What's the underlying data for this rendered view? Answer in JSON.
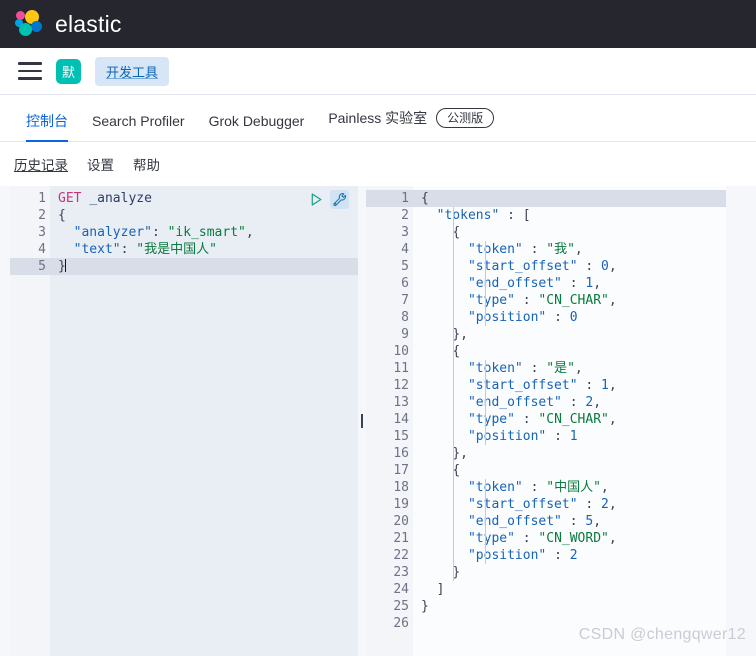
{
  "header": {
    "brand": "elastic",
    "logo_colors": {
      "pink": "#f04e98",
      "yellow": "#fec514",
      "light_blue": "#00a3e0",
      "blue": "#0077cc",
      "teal": "#00bfb3"
    },
    "background": "#25262e"
  },
  "nav": {
    "menu_icon": "hamburger-icon",
    "space_avatar_label": "默",
    "space_avatar_color": "#00bfb3",
    "breadcrumb": "开发工具",
    "breadcrumb_color": "#0b64b4"
  },
  "tabs": {
    "accent": "#0b64dd",
    "items": [
      {
        "label": "控制台",
        "active": true
      },
      {
        "label": "Search Profiler",
        "active": false
      },
      {
        "label": "Grok Debugger",
        "active": false
      },
      {
        "label": "Painless 实验室",
        "active": false,
        "badge": "公测版"
      }
    ]
  },
  "console_actions": [
    {
      "label": "历史记录",
      "underlined": true
    },
    {
      "label": "设置",
      "underlined": false
    },
    {
      "label": "帮助",
      "underlined": false
    }
  ],
  "request_editor": {
    "play_icon": "play-triangle-icon",
    "wrench_icon": "wrench-icon",
    "active_line": 5,
    "lines": [
      {
        "n": "1",
        "fold": "",
        "tokens": [
          {
            "t": "GET ",
            "c": "tk-method"
          },
          {
            "t": "_analyze",
            "c": "tk-url"
          }
        ]
      },
      {
        "n": "2",
        "fold": "▾",
        "tokens": [
          {
            "t": "{",
            "c": "tk-brace"
          }
        ]
      },
      {
        "n": "3",
        "fold": "",
        "tokens": [
          {
            "t": "  ",
            "c": "tk-punc"
          },
          {
            "t": "\"analyzer\"",
            "c": "tk-key"
          },
          {
            "t": ": ",
            "c": "tk-punc"
          },
          {
            "t": "\"ik_smart\"",
            "c": "tk-str"
          },
          {
            "t": ",",
            "c": "tk-punc"
          }
        ]
      },
      {
        "n": "4",
        "fold": "",
        "tokens": [
          {
            "t": "  ",
            "c": "tk-punc"
          },
          {
            "t": "\"text\"",
            "c": "tk-key"
          },
          {
            "t": ": ",
            "c": "tk-punc"
          },
          {
            "t": "\"我是中国人\"",
            "c": "tk-str"
          }
        ]
      },
      {
        "n": "5",
        "fold": "▴",
        "tokens": [
          {
            "t": "}",
            "c": "tk-brace"
          }
        ]
      }
    ]
  },
  "response_editor": {
    "active_line": 1,
    "lines": [
      {
        "n": "1",
        "fold": "▾",
        "tokens": [
          {
            "t": "{",
            "c": "tk-brace"
          }
        ]
      },
      {
        "n": "2",
        "fold": "▾",
        "tokens": [
          {
            "t": "  ",
            "c": "tk-punc"
          },
          {
            "t": "\"tokens\"",
            "c": "tk-key"
          },
          {
            "t": " : ",
            "c": "tk-punc"
          },
          {
            "t": "[",
            "c": "tk-brace"
          }
        ]
      },
      {
        "n": "3",
        "fold": "▾",
        "tokens": [
          {
            "t": "    ",
            "c": "tk-punc"
          },
          {
            "t": "{",
            "c": "tk-brace"
          }
        ]
      },
      {
        "n": "4",
        "fold": "",
        "tokens": [
          {
            "t": "      ",
            "c": "tk-punc"
          },
          {
            "t": "\"token\"",
            "c": "tk-key"
          },
          {
            "t": " : ",
            "c": "tk-punc"
          },
          {
            "t": "\"我\"",
            "c": "tk-str"
          },
          {
            "t": ",",
            "c": "tk-punc"
          }
        ]
      },
      {
        "n": "5",
        "fold": "",
        "tokens": [
          {
            "t": "      ",
            "c": "tk-punc"
          },
          {
            "t": "\"start_offset\"",
            "c": "tk-key"
          },
          {
            "t": " : ",
            "c": "tk-punc"
          },
          {
            "t": "0",
            "c": "tk-num"
          },
          {
            "t": ",",
            "c": "tk-punc"
          }
        ]
      },
      {
        "n": "6",
        "fold": "",
        "tokens": [
          {
            "t": "      ",
            "c": "tk-punc"
          },
          {
            "t": "\"end_offset\"",
            "c": "tk-key"
          },
          {
            "t": " : ",
            "c": "tk-punc"
          },
          {
            "t": "1",
            "c": "tk-num"
          },
          {
            "t": ",",
            "c": "tk-punc"
          }
        ]
      },
      {
        "n": "7",
        "fold": "",
        "tokens": [
          {
            "t": "      ",
            "c": "tk-punc"
          },
          {
            "t": "\"type\"",
            "c": "tk-key"
          },
          {
            "t": " : ",
            "c": "tk-punc"
          },
          {
            "t": "\"CN_CHAR\"",
            "c": "tk-str"
          },
          {
            "t": ",",
            "c": "tk-punc"
          }
        ]
      },
      {
        "n": "8",
        "fold": "",
        "tokens": [
          {
            "t": "      ",
            "c": "tk-punc"
          },
          {
            "t": "\"position\"",
            "c": "tk-key"
          },
          {
            "t": " : ",
            "c": "tk-punc"
          },
          {
            "t": "0",
            "c": "tk-num"
          }
        ]
      },
      {
        "n": "9",
        "fold": "▴",
        "tokens": [
          {
            "t": "    ",
            "c": "tk-punc"
          },
          {
            "t": "}",
            "c": "tk-brace"
          },
          {
            "t": ",",
            "c": "tk-punc"
          }
        ]
      },
      {
        "n": "10",
        "fold": "▾",
        "tokens": [
          {
            "t": "    ",
            "c": "tk-punc"
          },
          {
            "t": "{",
            "c": "tk-brace"
          }
        ]
      },
      {
        "n": "11",
        "fold": "",
        "tokens": [
          {
            "t": "      ",
            "c": "tk-punc"
          },
          {
            "t": "\"token\"",
            "c": "tk-key"
          },
          {
            "t": " : ",
            "c": "tk-punc"
          },
          {
            "t": "\"是\"",
            "c": "tk-str"
          },
          {
            "t": ",",
            "c": "tk-punc"
          }
        ]
      },
      {
        "n": "12",
        "fold": "",
        "tokens": [
          {
            "t": "      ",
            "c": "tk-punc"
          },
          {
            "t": "\"start_offset\"",
            "c": "tk-key"
          },
          {
            "t": " : ",
            "c": "tk-punc"
          },
          {
            "t": "1",
            "c": "tk-num"
          },
          {
            "t": ",",
            "c": "tk-punc"
          }
        ]
      },
      {
        "n": "13",
        "fold": "",
        "tokens": [
          {
            "t": "      ",
            "c": "tk-punc"
          },
          {
            "t": "\"end_offset\"",
            "c": "tk-key"
          },
          {
            "t": " : ",
            "c": "tk-punc"
          },
          {
            "t": "2",
            "c": "tk-num"
          },
          {
            "t": ",",
            "c": "tk-punc"
          }
        ]
      },
      {
        "n": "14",
        "fold": "",
        "tokens": [
          {
            "t": "      ",
            "c": "tk-punc"
          },
          {
            "t": "\"type\"",
            "c": "tk-key"
          },
          {
            "t": " : ",
            "c": "tk-punc"
          },
          {
            "t": "\"CN_CHAR\"",
            "c": "tk-str"
          },
          {
            "t": ",",
            "c": "tk-punc"
          }
        ]
      },
      {
        "n": "15",
        "fold": "",
        "tokens": [
          {
            "t": "      ",
            "c": "tk-punc"
          },
          {
            "t": "\"position\"",
            "c": "tk-key"
          },
          {
            "t": " : ",
            "c": "tk-punc"
          },
          {
            "t": "1",
            "c": "tk-num"
          }
        ]
      },
      {
        "n": "16",
        "fold": "▴",
        "tokens": [
          {
            "t": "    ",
            "c": "tk-punc"
          },
          {
            "t": "}",
            "c": "tk-brace"
          },
          {
            "t": ",",
            "c": "tk-punc"
          }
        ]
      },
      {
        "n": "17",
        "fold": "▾",
        "tokens": [
          {
            "t": "    ",
            "c": "tk-punc"
          },
          {
            "t": "{",
            "c": "tk-brace"
          }
        ]
      },
      {
        "n": "18",
        "fold": "",
        "tokens": [
          {
            "t": "      ",
            "c": "tk-punc"
          },
          {
            "t": "\"token\"",
            "c": "tk-key"
          },
          {
            "t": " : ",
            "c": "tk-punc"
          },
          {
            "t": "\"中国人\"",
            "c": "tk-str"
          },
          {
            "t": ",",
            "c": "tk-punc"
          }
        ]
      },
      {
        "n": "19",
        "fold": "",
        "tokens": [
          {
            "t": "      ",
            "c": "tk-punc"
          },
          {
            "t": "\"start_offset\"",
            "c": "tk-key"
          },
          {
            "t": " : ",
            "c": "tk-punc"
          },
          {
            "t": "2",
            "c": "tk-num"
          },
          {
            "t": ",",
            "c": "tk-punc"
          }
        ]
      },
      {
        "n": "20",
        "fold": "",
        "tokens": [
          {
            "t": "      ",
            "c": "tk-punc"
          },
          {
            "t": "\"end_offset\"",
            "c": "tk-key"
          },
          {
            "t": " : ",
            "c": "tk-punc"
          },
          {
            "t": "5",
            "c": "tk-num"
          },
          {
            "t": ",",
            "c": "tk-punc"
          }
        ]
      },
      {
        "n": "21",
        "fold": "",
        "tokens": [
          {
            "t": "      ",
            "c": "tk-punc"
          },
          {
            "t": "\"type\"",
            "c": "tk-key"
          },
          {
            "t": " : ",
            "c": "tk-punc"
          },
          {
            "t": "\"CN_WORD\"",
            "c": "tk-str"
          },
          {
            "t": ",",
            "c": "tk-punc"
          }
        ]
      },
      {
        "n": "22",
        "fold": "",
        "tokens": [
          {
            "t": "      ",
            "c": "tk-punc"
          },
          {
            "t": "\"position\"",
            "c": "tk-key"
          },
          {
            "t": " : ",
            "c": "tk-punc"
          },
          {
            "t": "2",
            "c": "tk-num"
          }
        ]
      },
      {
        "n": "23",
        "fold": "▴",
        "tokens": [
          {
            "t": "    ",
            "c": "tk-punc"
          },
          {
            "t": "}",
            "c": "tk-brace"
          }
        ]
      },
      {
        "n": "24",
        "fold": "▴",
        "tokens": [
          {
            "t": "  ",
            "c": "tk-punc"
          },
          {
            "t": "]",
            "c": "tk-brace"
          }
        ]
      },
      {
        "n": "25",
        "fold": "▴",
        "tokens": [
          {
            "t": "}",
            "c": "tk-brace"
          }
        ]
      },
      {
        "n": "26",
        "fold": "",
        "tokens": []
      }
    ]
  },
  "resize_handle": {
    "icon": "vertical-grip-icon"
  },
  "watermark": "CSDN @chengqwer12"
}
